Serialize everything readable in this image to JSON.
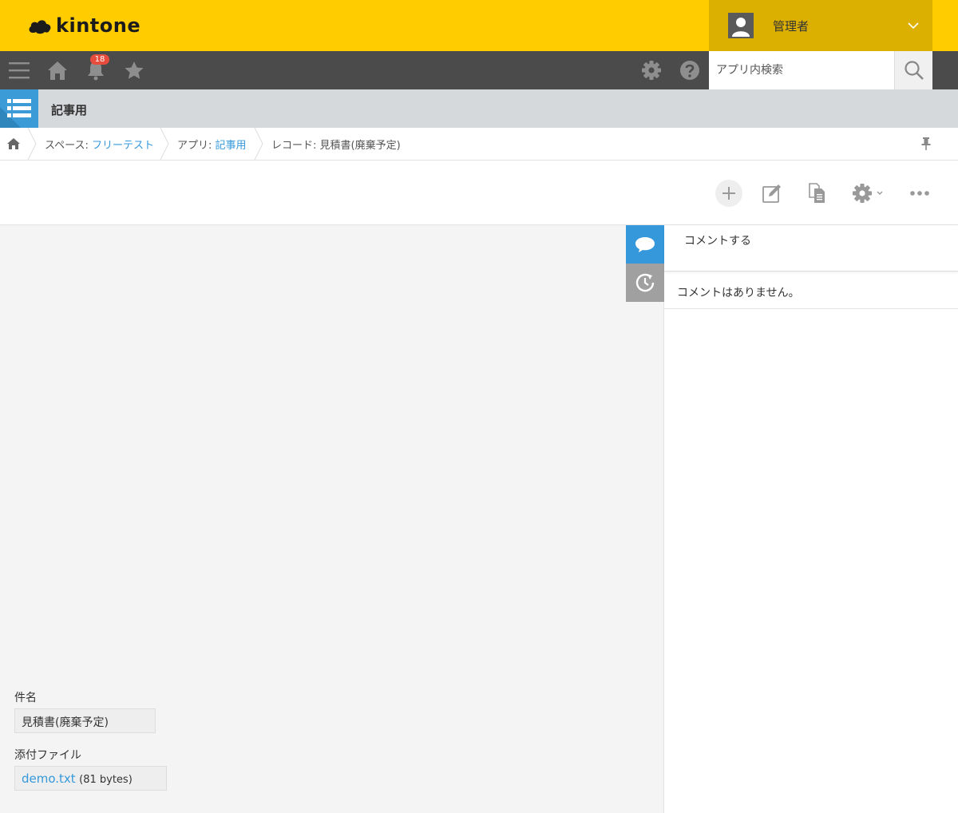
{
  "header": {
    "logo_text": "kintone",
    "user_name": "管理者",
    "accent_color": "#ffcc00",
    "user_bg_color": "#dcb000"
  },
  "toolbar": {
    "notification_count": "18",
    "search_placeholder": "アプリ内検索",
    "icons": [
      "menu-icon",
      "home-icon",
      "bell-icon",
      "star-icon",
      "gear-icon",
      "help-icon",
      "search-icon"
    ]
  },
  "app": {
    "title": "記事用"
  },
  "breadcrumb": {
    "space_label": "スペース: ",
    "space_name": "フリーテスト",
    "app_label": "アプリ: ",
    "app_name": "記事用",
    "record_label": "レコード: 見積書(廃棄予定)"
  },
  "record": {
    "fields": [
      {
        "label": "件名",
        "value": "見積書(廃棄予定)"
      },
      {
        "label": "添付ファイル",
        "file_name": "demo.txt",
        "file_size": "(81 bytes)"
      }
    ]
  },
  "comments": {
    "input_placeholder": "コメントする",
    "empty_text": "コメントはありません。"
  },
  "colors": {
    "toolbar_bg": "#4b4b4b",
    "link": "#3498db",
    "comment_tab_active": "#3498db",
    "history_tab": "#a0a0a0"
  }
}
